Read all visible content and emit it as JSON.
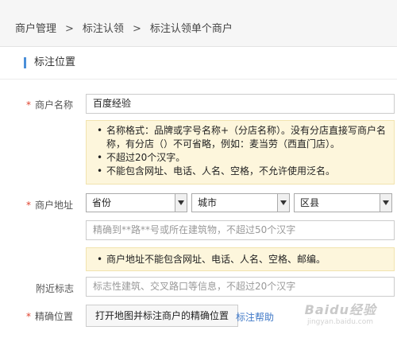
{
  "breadcrumb": {
    "items": [
      "商户管理",
      "标注认领",
      "标注认领单个商户"
    ],
    "separator": ">"
  },
  "section_title": "标注位置",
  "form": {
    "required_mark": "*",
    "name": {
      "label": "商户名称",
      "value": "百度经验",
      "tips": [
        "名称格式：品牌或字号名称+（分店名称）。没有分店直接写商户名称，有分店（）不可省略，例如：麦当劳（西直门店）。",
        "不超过20个汉字。",
        "不能包含网址、电话、人名、空格，不允许使用泛名。"
      ]
    },
    "address": {
      "label": "商户地址",
      "province": "省份",
      "city": "城市",
      "district": "区县",
      "placeholder": "精确到**路**号或所在建筑物，不超过50个汉字",
      "tips": [
        "商户地址不能包含网址、电话、人名、空格、邮编。"
      ]
    },
    "landmark": {
      "label": "附近标志",
      "placeholder": "标志性建筑、交叉路口等信息，不超过20个汉字"
    },
    "location": {
      "label": "精确位置",
      "button": "打开地图并标注商户的精确位置",
      "help": "标注帮助"
    }
  },
  "watermark": {
    "logo": "Baidu经验",
    "url": "jingyan.baidu.com"
  },
  "colors": {
    "accent": "#4a8fd8",
    "required": "#e0432f",
    "link": "#3f78c7",
    "note_bg": "#fdf6dc",
    "note_border": "#f1e3ae"
  }
}
